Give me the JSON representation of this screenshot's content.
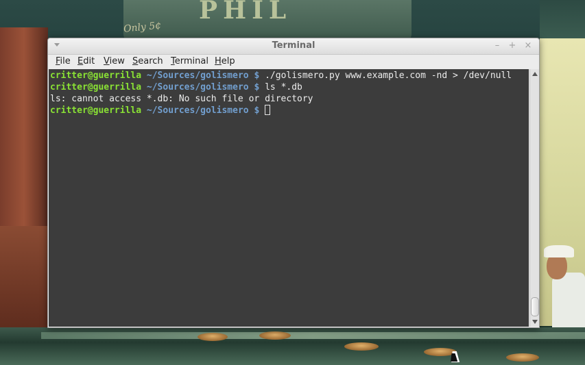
{
  "window": {
    "title": "Terminal",
    "controls": {
      "minimize": "–",
      "maximize": "+",
      "close": "×"
    }
  },
  "menu": [
    "File",
    "Edit",
    "View",
    "Search",
    "Terminal",
    "Help"
  ],
  "terminal": {
    "prompt_user": "critter@guerrilla",
    "prompt_path": "~/Sources/golismero",
    "prompt_symbol": "$",
    "lines": [
      {
        "type": "command",
        "text": "./golismero.py www.example.com -nd > /dev/null"
      },
      {
        "type": "command",
        "text": "ls *.db"
      },
      {
        "type": "output",
        "text": "ls: cannot access *.db: No such file or directory"
      },
      {
        "type": "prompt",
        "text": ""
      }
    ]
  },
  "wallpaper": {
    "sign_text": "PHIL",
    "sign_sub": "Only 5¢"
  },
  "colors": {
    "terminal_bg": "#3c3c3c",
    "prompt_user": "#8ae234",
    "prompt_path": "#729fcf",
    "text": "#ededed"
  }
}
